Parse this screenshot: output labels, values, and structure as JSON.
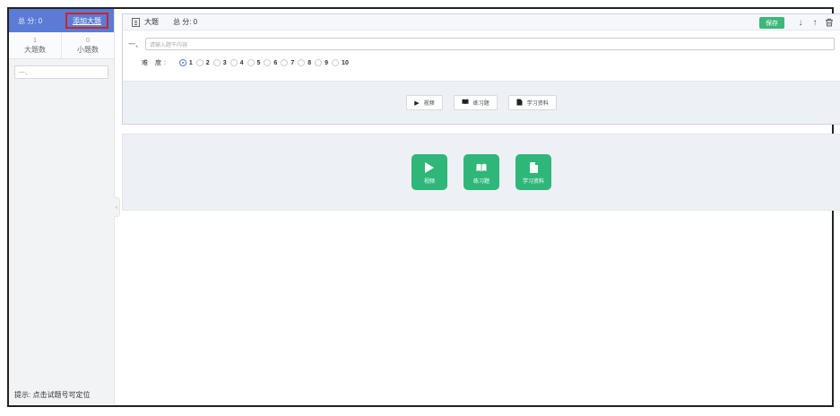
{
  "sidebar": {
    "total_label": "总 分: 0",
    "add_button": "添加大题",
    "stats": [
      {
        "num": "1",
        "label": "大题数"
      },
      {
        "num": "0",
        "label": "小题数"
      }
    ],
    "item_text": "一、",
    "tip": "提示: 点击试题号可定位"
  },
  "question": {
    "title": "大题",
    "score_label": "总 分: 0",
    "save": "保存",
    "stem_prefix": "一、",
    "stem_placeholder": "请输入题干内容",
    "difficulty_label": "难 度:",
    "difficulty_options": [
      "1",
      "2",
      "3",
      "4",
      "5",
      "6",
      "7",
      "8",
      "9",
      "10"
    ],
    "difficulty_selected": "1",
    "footer_buttons": [
      {
        "icon": "play-icon",
        "label": "视频"
      },
      {
        "icon": "book-icon",
        "label": "练习题"
      },
      {
        "icon": "document-icon",
        "label": "学习资料"
      }
    ]
  },
  "resources": [
    {
      "icon": "play-icon",
      "label": "视频"
    },
    {
      "icon": "book-icon",
      "label": "练习题"
    },
    {
      "icon": "document-icon",
      "label": "学习资料"
    }
  ],
  "colors": {
    "header_blue": "#5b7bd5",
    "save_green": "#3cb878",
    "tile_green": "#2fb77a",
    "highlight_red": "#c8262b"
  }
}
